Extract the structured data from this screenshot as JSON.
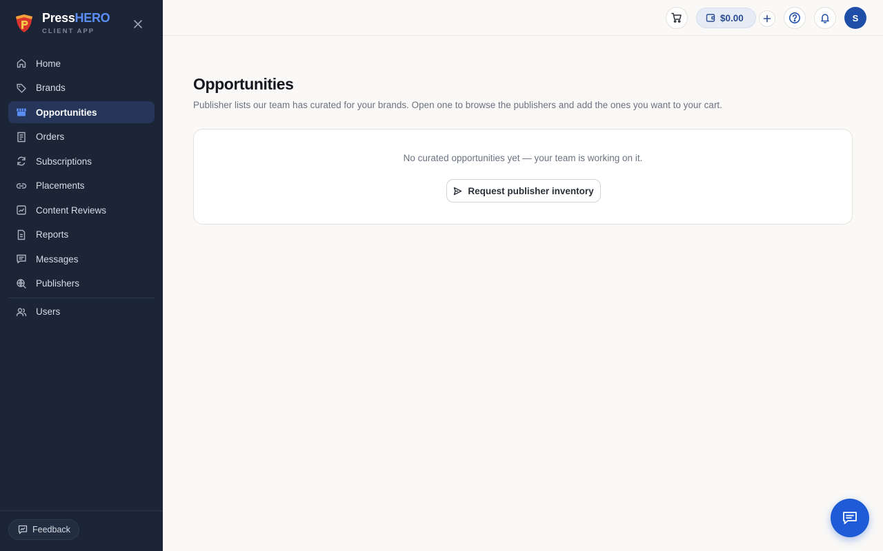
{
  "brand": {
    "name_part1": "Press",
    "name_part2": "HERO",
    "subtitle": "CLIENT APP"
  },
  "sidebar": {
    "items": [
      {
        "label": "Home",
        "icon": "home-icon",
        "active": false
      },
      {
        "label": "Brands",
        "icon": "tag-icon",
        "active": false
      },
      {
        "label": "Opportunities",
        "icon": "storefront-icon",
        "active": true
      },
      {
        "label": "Orders",
        "icon": "receipt-icon",
        "active": false
      },
      {
        "label": "Subscriptions",
        "icon": "refresh-icon",
        "active": false
      },
      {
        "label": "Placements",
        "icon": "link-icon",
        "active": false
      },
      {
        "label": "Content Reviews",
        "icon": "chart-review-icon",
        "active": false
      },
      {
        "label": "Reports",
        "icon": "document-icon",
        "active": false
      },
      {
        "label": "Messages",
        "icon": "message-icon",
        "active": false
      },
      {
        "label": "Publishers",
        "icon": "globe-search-icon",
        "active": false
      }
    ],
    "secondary_items": [
      {
        "label": "Users",
        "icon": "users-icon",
        "active": false
      }
    ],
    "feedback_label": "Feedback"
  },
  "topbar": {
    "wallet_amount": "$0.00",
    "avatar_initial": "S"
  },
  "main": {
    "title": "Opportunities",
    "description": "Publisher lists our team has curated for your brands. Open one to browse the publishers and add the ones you want to your cart.",
    "empty_message": "No curated opportunities yet — your team is working on it.",
    "request_button_label": "Request publisher inventory"
  },
  "colors": {
    "sidebar_bg": "#1b2535",
    "accent": "#1f5ad7",
    "active_nav_bg": "#25365a",
    "brand_hero": "#5b8ef5"
  }
}
